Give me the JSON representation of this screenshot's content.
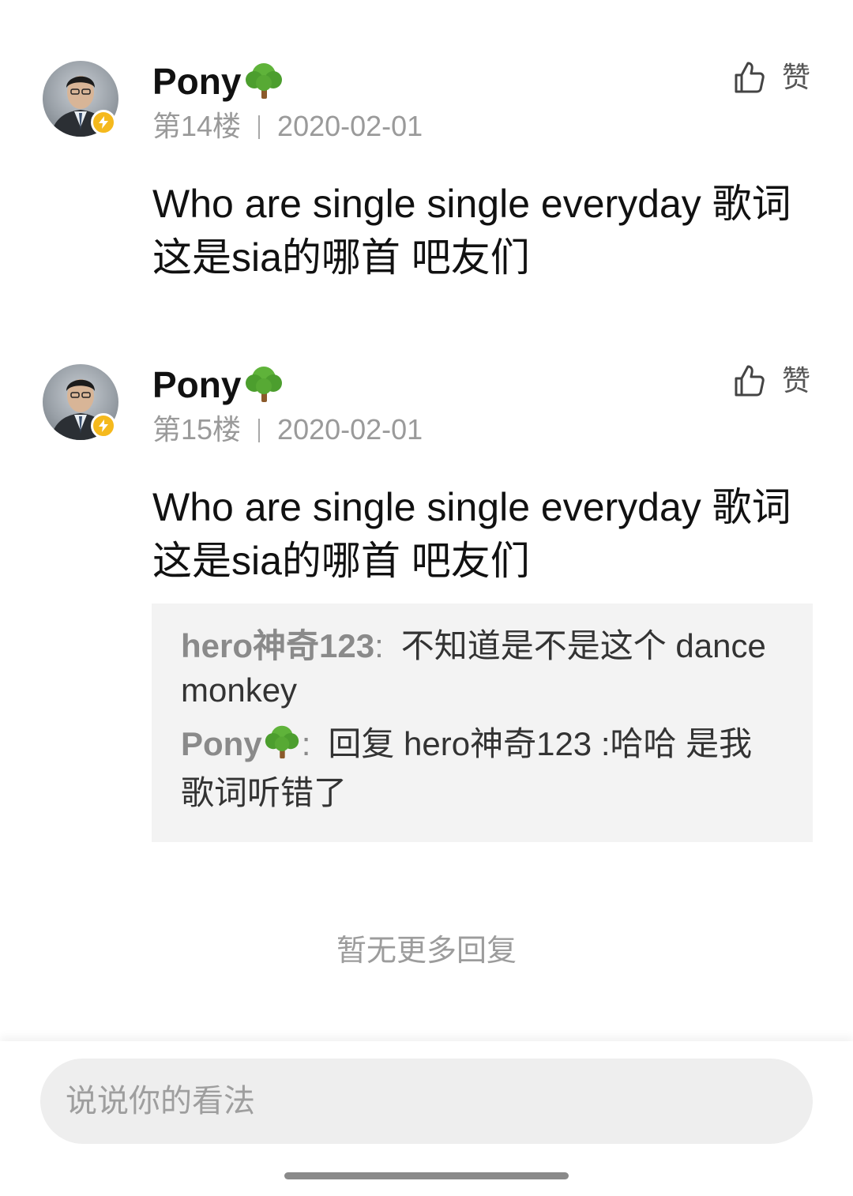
{
  "posts": [
    {
      "username": "Pony",
      "floor": "第14楼",
      "date": "2020-02-01",
      "like_label": "赞",
      "content": "Who are single single everyday 歌词 这是sia的哪首 吧友们"
    },
    {
      "username": "Pony",
      "floor": "第15楼",
      "date": "2020-02-01",
      "like_label": "赞",
      "content": "Who are single single everyday 歌词 这是sia的哪首 吧友们",
      "replies": [
        {
          "user": "hero神奇123",
          "colon": ":",
          "text": "不知道是不是这个 dance monkey"
        },
        {
          "user": "Pony",
          "colon": ":",
          "text": "回复 hero神奇123 :哈哈 是我歌词听错了"
        }
      ]
    }
  ],
  "no_more_replies": "暂无更多回复",
  "comment_box": {
    "placeholder": "说说你的看法"
  },
  "colors": {
    "meta_gray": "#9a9a9a",
    "reply_bg": "#f3f3f3",
    "badge_yellow": "#f5b91d",
    "input_bg": "#eeeeee"
  },
  "icons": [
    "avatar",
    "lightning-badge-icon",
    "tree-emoji-icon",
    "thumbs-up-icon"
  ]
}
